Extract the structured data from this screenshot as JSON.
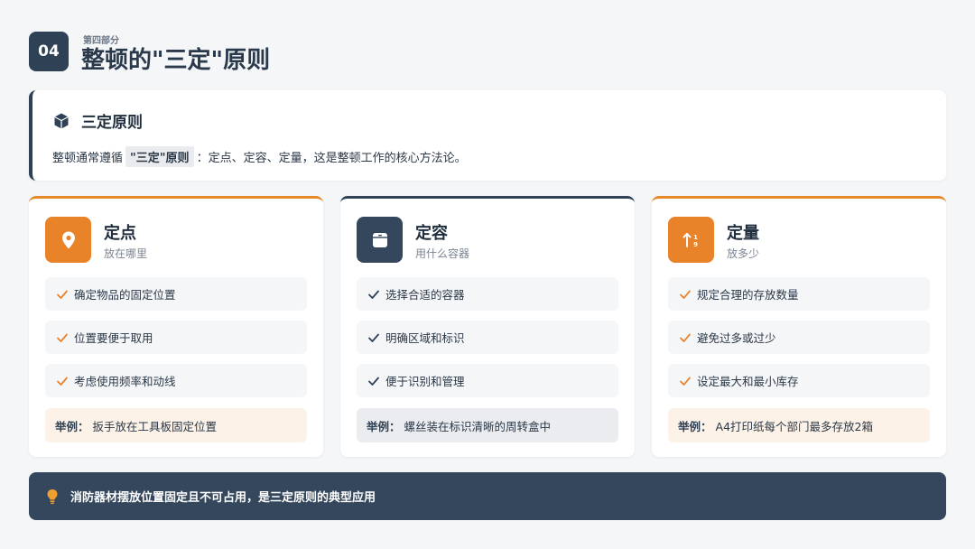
{
  "header": {
    "badge": "04",
    "subtitle": "第四部分",
    "title": "整顿的\"三定\"原则"
  },
  "principle": {
    "icon": "cube-icon",
    "title": "三定原则",
    "desc_prefix": "整顿通常遵循",
    "desc_highlight": "\"三定\"原则",
    "desc_suffix": "：定点、定容、定量，这是整顿工作的核心方法论。"
  },
  "cards": [
    {
      "icon": "location-pin-icon",
      "title": "定点",
      "subtitle": "放在哪里",
      "items": [
        "确定物品的固定位置",
        "位置要便于取用",
        "考虑使用频率和动线"
      ],
      "example_label": "举例：",
      "example": "扳手放在工具板固定位置"
    },
    {
      "icon": "box-icon",
      "title": "定容",
      "subtitle": "用什么容器",
      "items": [
        "选择合适的容器",
        "明确区域和标识",
        "便于识别和管理"
      ],
      "example_label": "举例：",
      "example": "螺丝装在标识清晰的周转盒中"
    },
    {
      "icon": "sort-amount-icon",
      "title": "定量",
      "subtitle": "放多少",
      "items": [
        "规定合理的存放数量",
        "避免过多或过少",
        "设定最大和最小库存"
      ],
      "example_label": "举例：",
      "example": "A4打印纸每个部门最多存放2箱"
    }
  ],
  "footer": {
    "icon": "lightbulb-icon",
    "text": "消防器材摆放位置固定且不可占用，是三定原则的典型应用"
  },
  "colors": {
    "accent": "#e8832a",
    "dark": "#34475c"
  }
}
